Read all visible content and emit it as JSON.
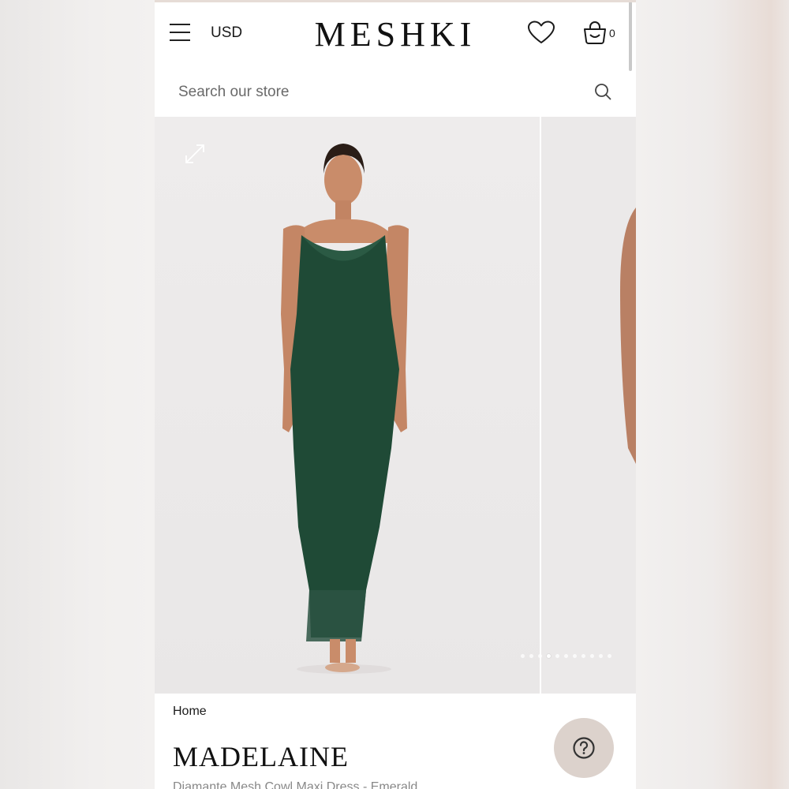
{
  "header": {
    "currency_label": "USD",
    "logo_text": "MESHKI",
    "cart_count": "0",
    "icons": {
      "menu": "hamburger-menu-icon",
      "wishlist": "heart-icon",
      "cart": "shopping-bag-icon"
    }
  },
  "search": {
    "placeholder": "Search our store",
    "icon": "search-icon"
  },
  "gallery": {
    "expand_icon": "expand-icon",
    "dot_count": 11,
    "active_dot_index": 3,
    "product_color": "#1f4a36"
  },
  "product": {
    "breadcrumb": "Home",
    "title": "MADELAINE",
    "subtitle": "Diamante Mesh Cowl Maxi Dress - Emerald"
  },
  "help": {
    "icon": "question-mark-icon"
  }
}
